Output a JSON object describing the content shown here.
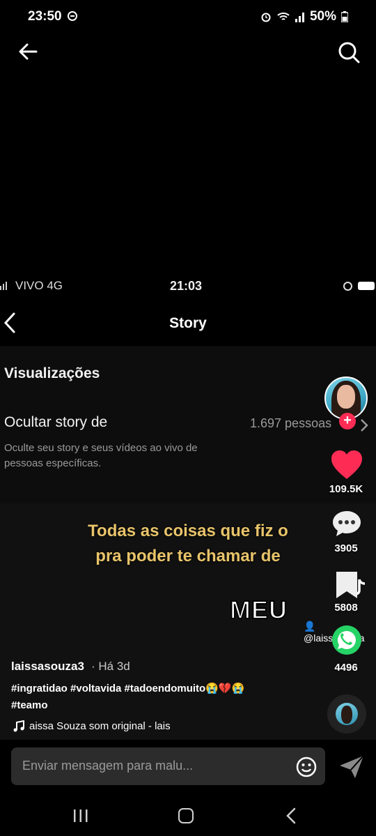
{
  "status_bar": {
    "time": "23:50",
    "battery": "50%"
  },
  "top_nav": {
    "back_icon": "arrow-left-icon",
    "search_icon": "search-icon"
  },
  "video": {
    "inner_status": {
      "carrier": "VIVO  4G",
      "time": "21:03"
    },
    "story_header": {
      "title": "Story"
    },
    "settings": {
      "visualizacoes": "Visualizações",
      "ocultar_title": "Ocultar story de",
      "ocultar_count": "1.697 pessoas",
      "ocultar_desc": "Oculte seu story e seus vídeos ao vivo de pessoas específicas."
    },
    "caption_line1": "Todas as coisas que fiz o",
    "caption_line2": "pra poder te chamar de",
    "caption_meu": "MEU",
    "watermark_logo": "TikTok",
    "watermark_handle": "@laissasouza"
  },
  "rail": {
    "likes": "109.5K",
    "comments": "3905",
    "saves": "5808",
    "shares": "4496",
    "accent": "#fe2c55"
  },
  "post": {
    "username": "laissasouza3",
    "age": "· Há 3d",
    "hashtags_line1": "#ingratidao #voltavida #tadoendomuito😭💔😭",
    "hashtags_line2": "#teamo",
    "music": "aissa Souza     som original - lais"
  },
  "message_bar": {
    "placeholder": "Enviar mensagem para malu..."
  }
}
